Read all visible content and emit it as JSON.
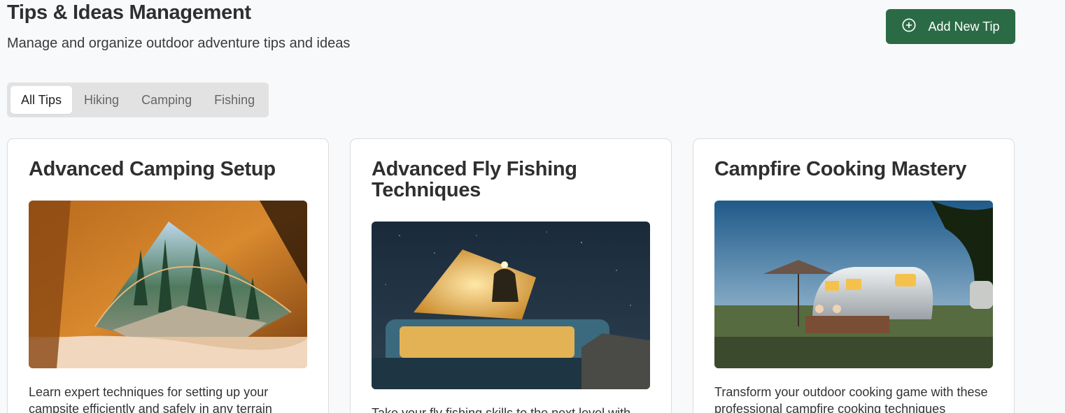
{
  "header": {
    "title": "Tips & Ideas Management",
    "subtitle": "Manage and organize outdoor adventure tips and ideas",
    "add_button_label": "Add New Tip",
    "add_button_icon": "plus-circle-icon",
    "accent_color": "#2a6b45"
  },
  "filters": {
    "tabs": [
      {
        "label": "All Tips",
        "active": true
      },
      {
        "label": "Hiking",
        "active": false
      },
      {
        "label": "Camping",
        "active": false
      },
      {
        "label": "Fishing",
        "active": false
      }
    ]
  },
  "cards": [
    {
      "title": "Advanced Camping Setup",
      "image": "tent-interior-forest-view-photo",
      "description": "Learn expert techniques for setting up your campsite efficiently and safely in any terrain"
    },
    {
      "title": "Advanced Fly Fishing Techniques",
      "image": "campervan-night-sky-photo",
      "description": "Take your fly fishing skills to the next level with"
    },
    {
      "title": "Campfire Cooking Mastery",
      "image": "vintage-trailer-dusk-photo",
      "description": "Transform your outdoor cooking game with these professional campfire cooking techniques"
    }
  ]
}
